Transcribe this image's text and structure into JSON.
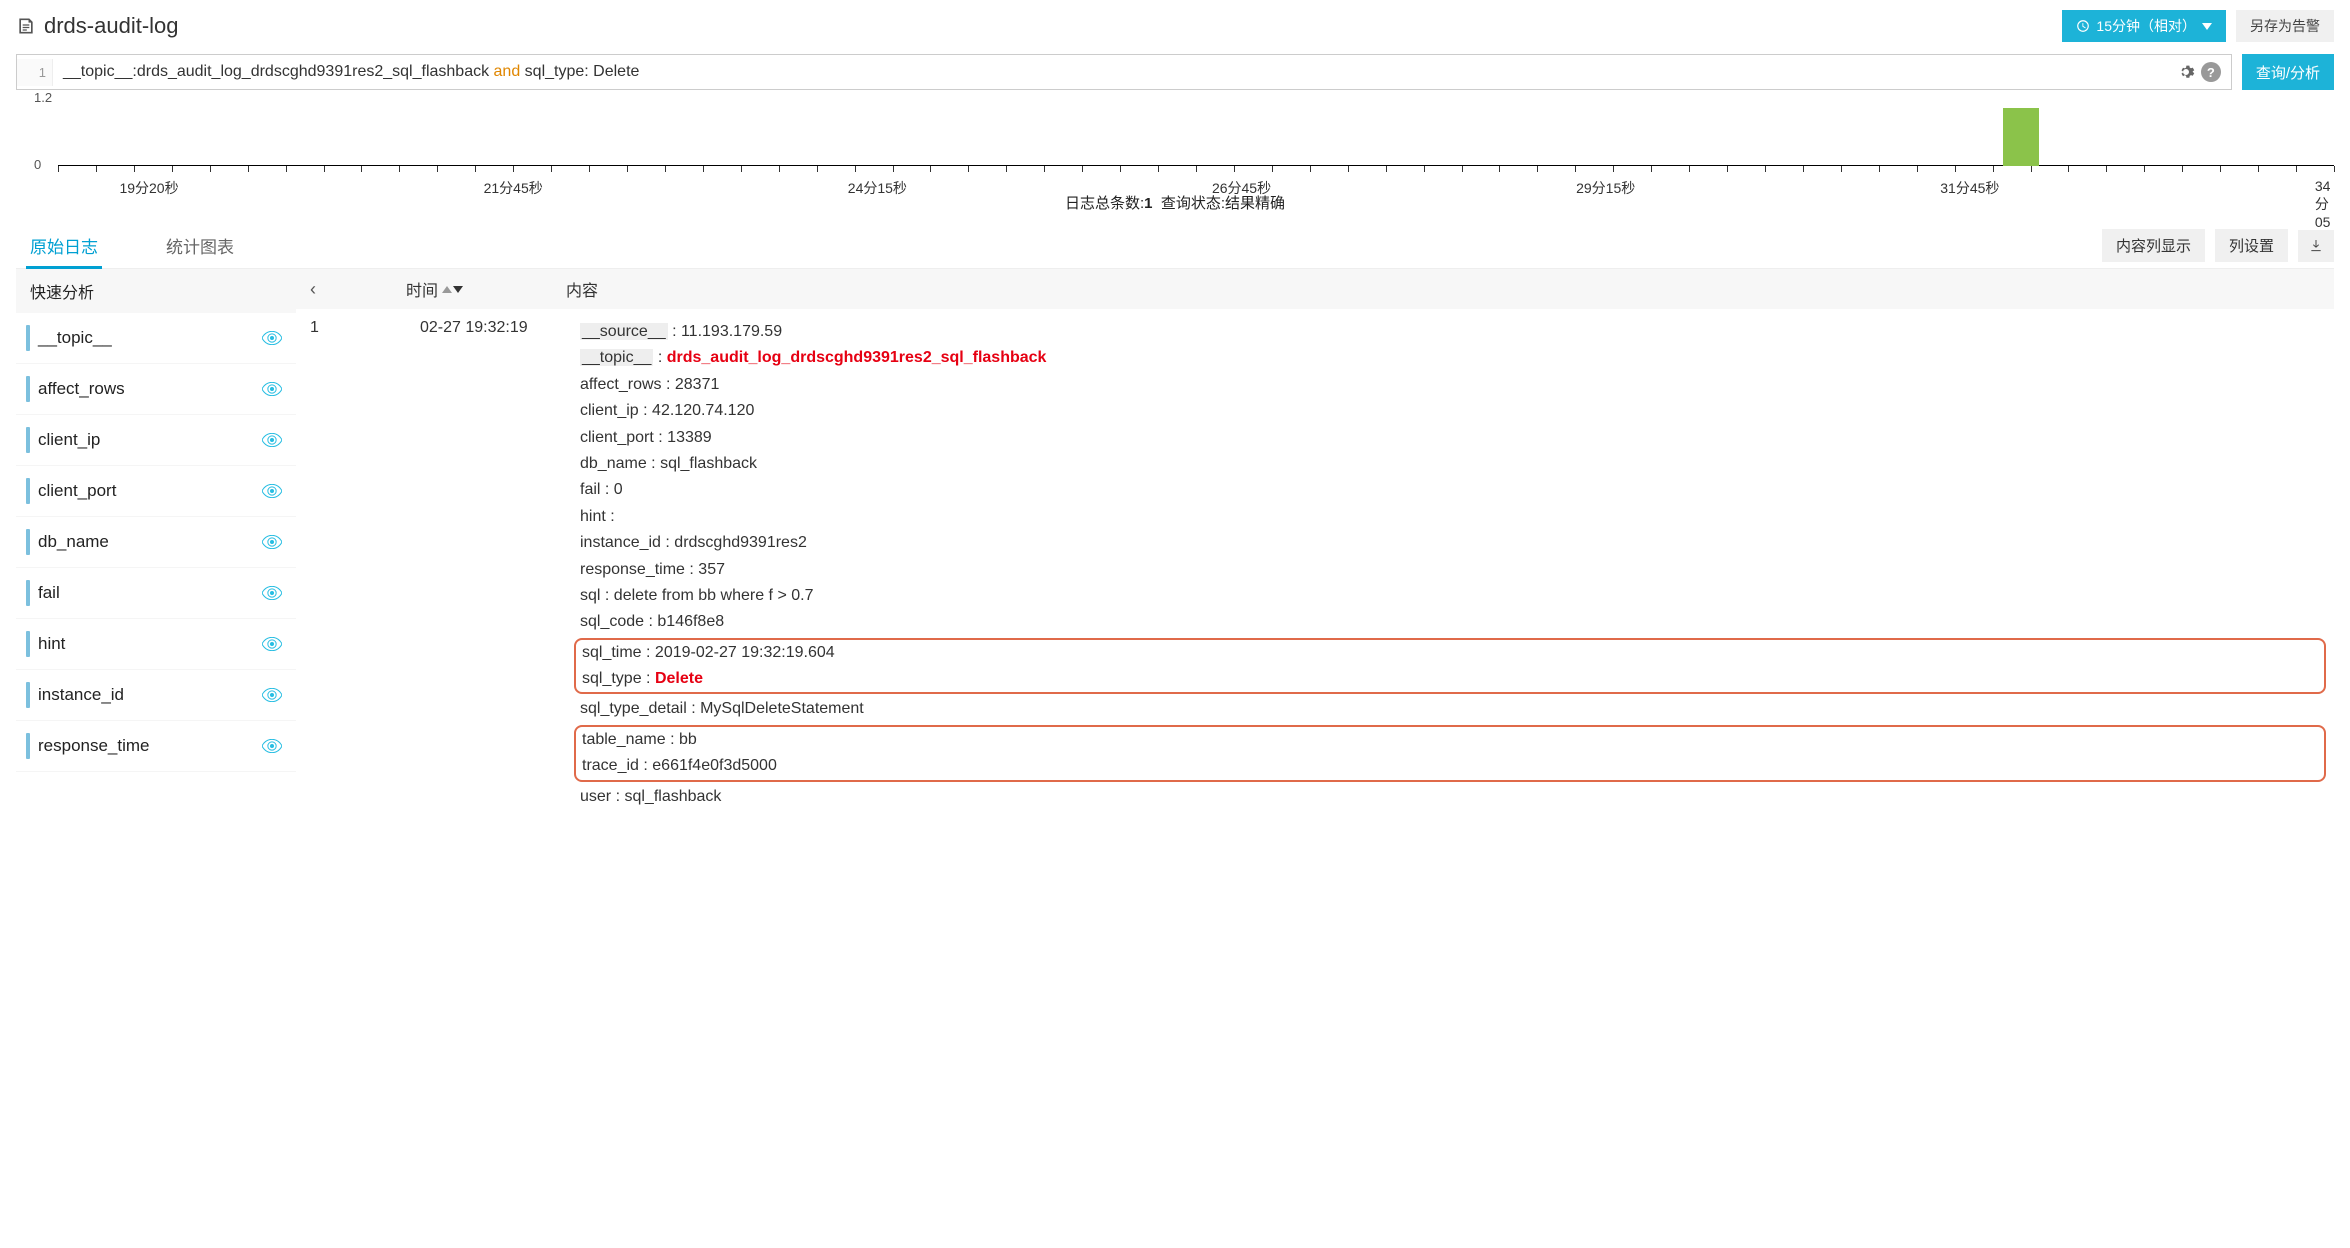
{
  "header": {
    "title": "drds-audit-log",
    "time_picker_label": "15分钟（相对）",
    "save_alert_label": "另存为告警"
  },
  "search": {
    "line_num": "1",
    "query_prefix": "__topic__:drds_audit_log_drdscghd9391res2_sql_flashback ",
    "query_kw": "and",
    "query_suffix": " sql_type: Delete",
    "analyze_btn": "查询/分析"
  },
  "chart_data": {
    "type": "bar",
    "ylim": [
      "0",
      "1.2"
    ],
    "x_labels": [
      "19分20秒",
      "21分45秒",
      "24分15秒",
      "26分45秒",
      "29分15秒",
      "31分45秒",
      "34分05"
    ],
    "x_label_positions": [
      4,
      20,
      36,
      52,
      68,
      84,
      99.5
    ],
    "bar": {
      "x_pct": 85.6,
      "height_frac": 0.83
    }
  },
  "status": {
    "total_label": "日志总条数:",
    "total_value": "1",
    "state_label": "查询状态:",
    "state_value": "结果精确"
  },
  "tabs": {
    "raw": "原始日志",
    "stats": "统计图表",
    "content_col_btn": "内容列显示",
    "col_settings_btn": "列设置"
  },
  "columns": {
    "quick_analysis": "快速分析",
    "time": "时间",
    "content": "内容"
  },
  "fields": [
    "__topic__",
    "affect_rows",
    "client_ip",
    "client_port",
    "db_name",
    "fail",
    "hint",
    "instance_id",
    "response_time"
  ],
  "log": {
    "seq": "1",
    "time": "02-27 19:32:19",
    "entries": [
      {
        "key": "__source__",
        "bgkey": true,
        "val": "11.193.179.59"
      },
      {
        "key": "__topic__",
        "bgkey": true,
        "val": "drds_audit_log_drdscghd9391res2_sql_flashback",
        "red": true
      },
      {
        "key": "affect_rows",
        "val": "28371"
      },
      {
        "key": "client_ip",
        "val": "42.120.74.120"
      },
      {
        "key": "client_port",
        "val": "13389"
      },
      {
        "key": "db_name",
        "val": "sql_flashback"
      },
      {
        "key": "fail",
        "val": "0"
      },
      {
        "key": "hint",
        "val": ""
      },
      {
        "key": "instance_id",
        "val": "drdscghd9391res2"
      },
      {
        "key": "response_time",
        "val": "357"
      },
      {
        "key": "sql",
        "val": "delete from bb where f > 0.7"
      },
      {
        "key": "sql_code",
        "val": "b146f8e8"
      },
      {
        "key": "sql_time",
        "val": "2019-02-27 19:32:19.604",
        "hi_start": true
      },
      {
        "key": "sql_type",
        "val": "Delete",
        "red": true,
        "hi_end": true
      },
      {
        "key": "sql_type_detail",
        "val": "MySqlDeleteStatement"
      },
      {
        "key": "table_name",
        "val": "bb",
        "hi_start": true
      },
      {
        "key": "trace_id",
        "val": "e661f4e0f3d5000",
        "hi_end": true
      },
      {
        "key": "user",
        "val": "sql_flashback"
      }
    ]
  }
}
